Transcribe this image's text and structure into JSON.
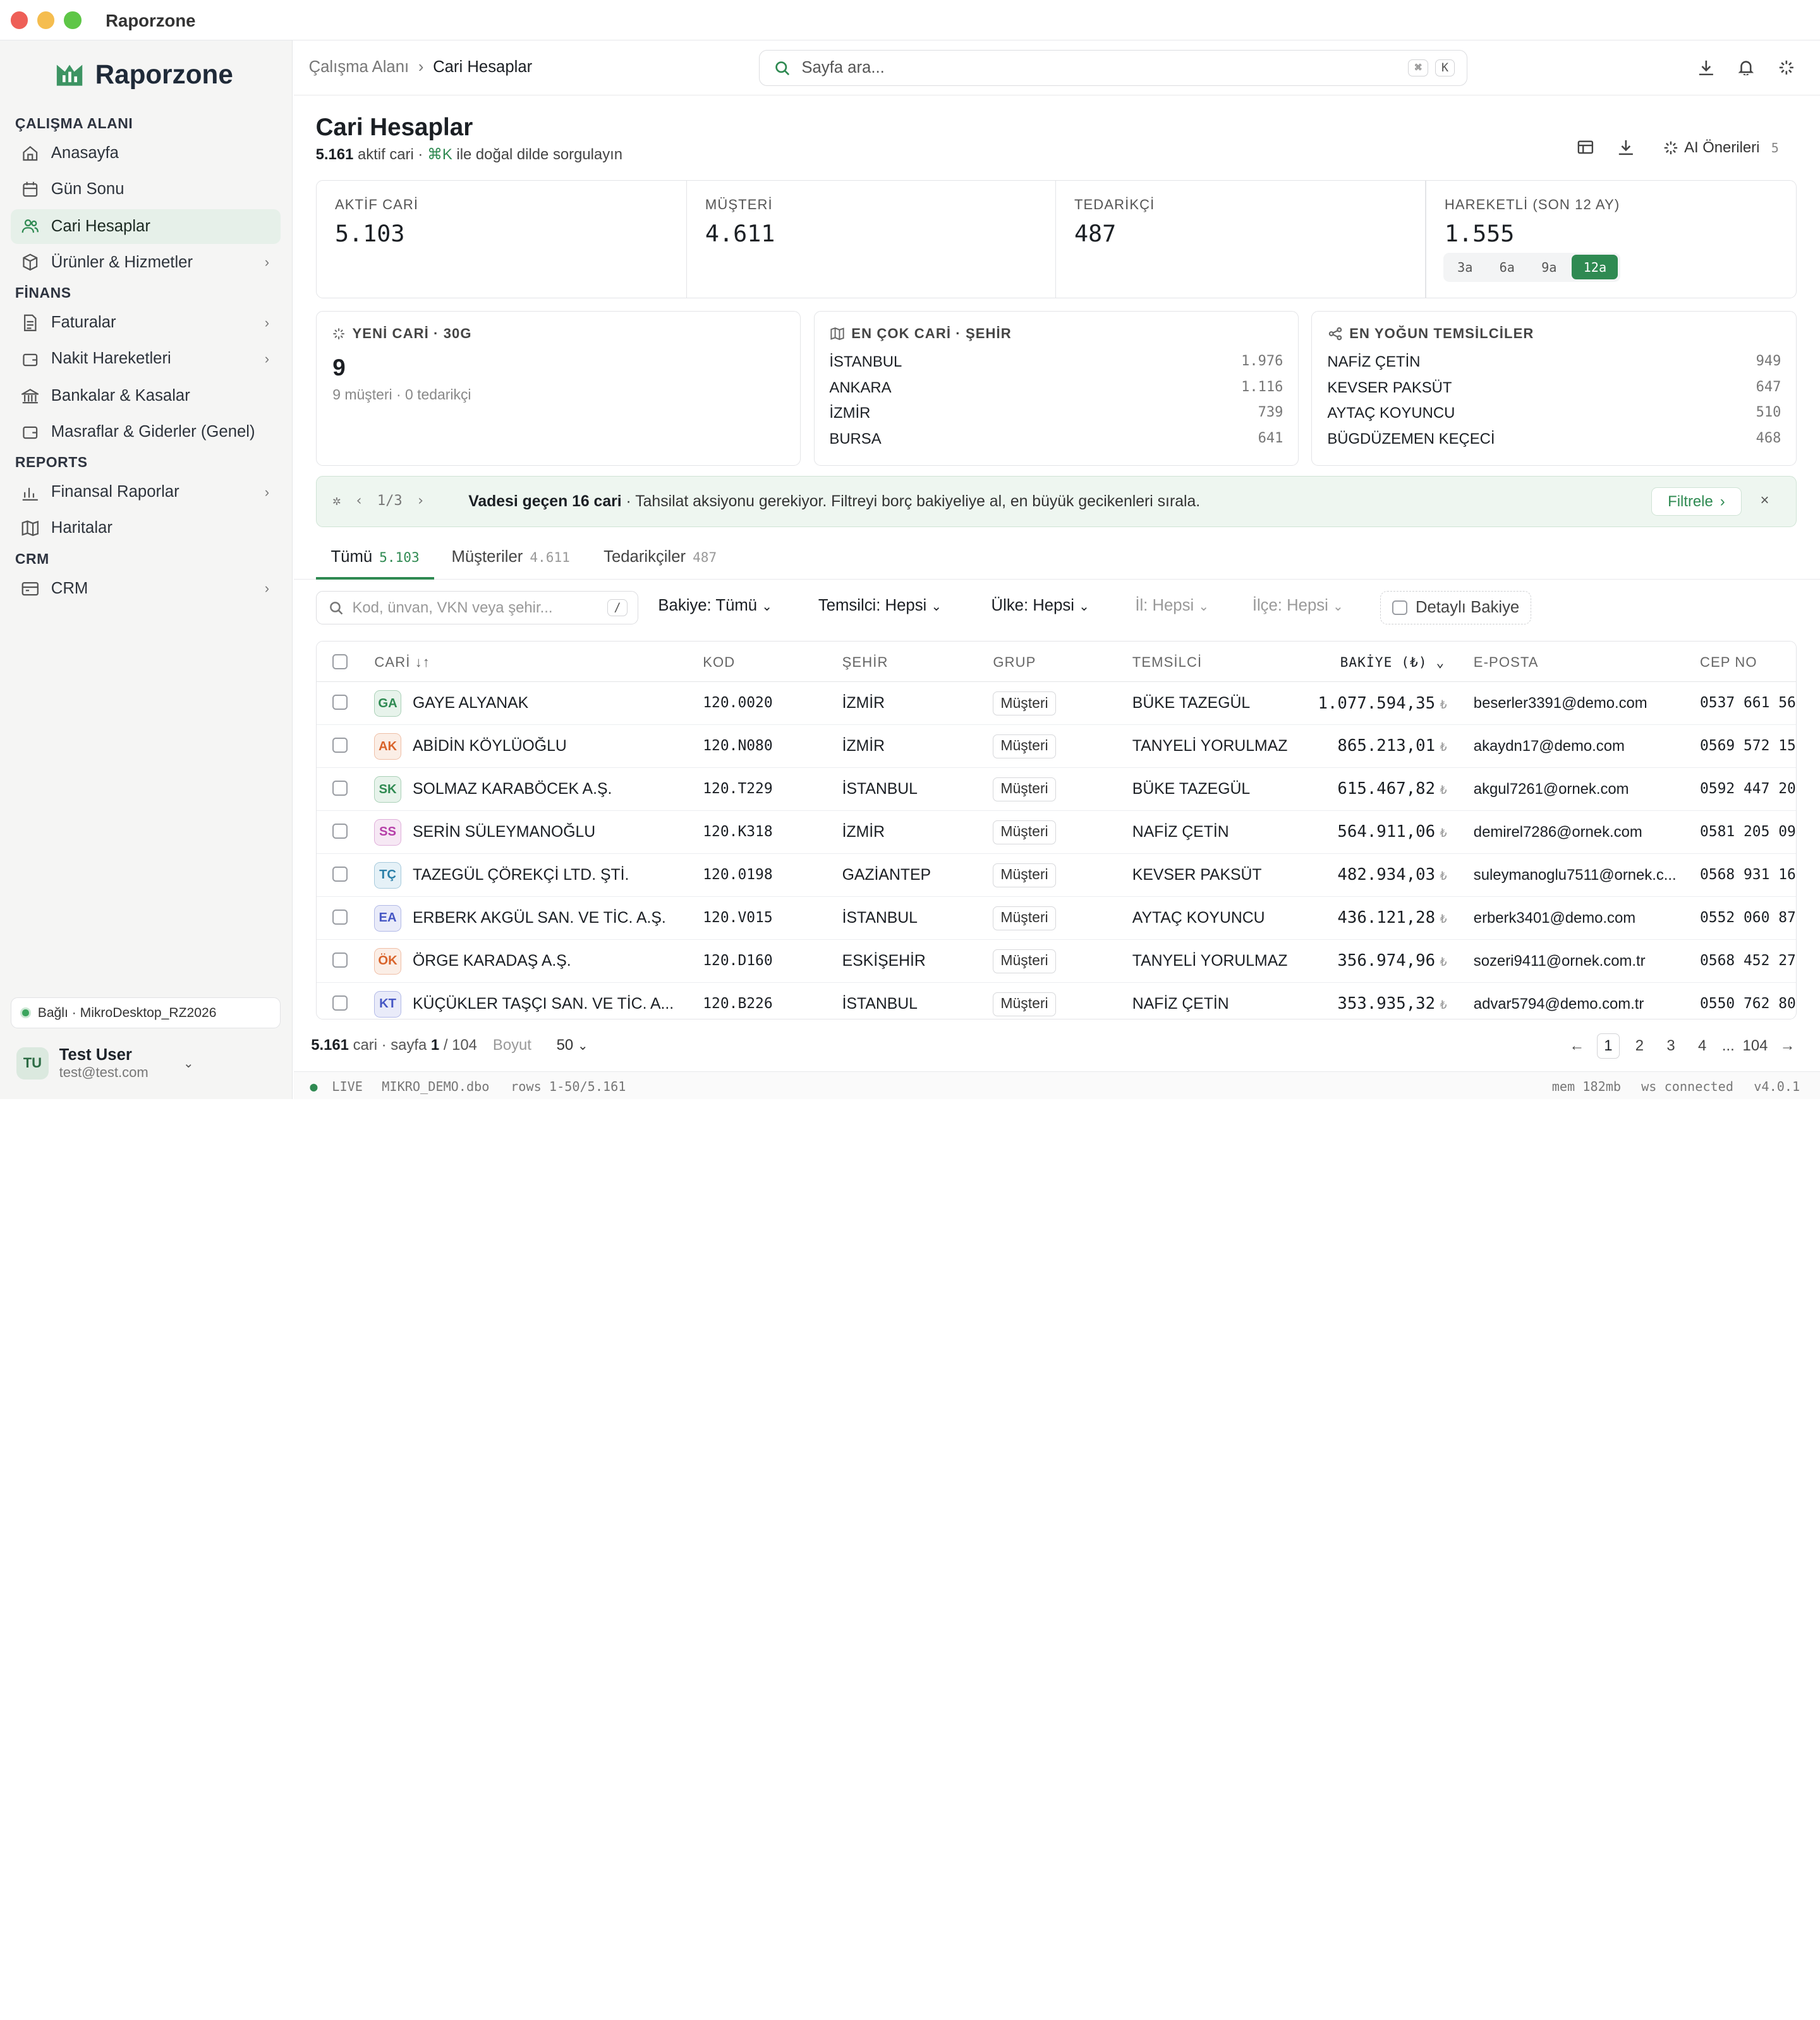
{
  "window": {
    "title": "Raporzone",
    "controls": {
      "close": "#ee5f57",
      "minimize": "#f5bd4f",
      "maximize": "#5ec647"
    }
  },
  "sidebar": {
    "brand": "Raporzone",
    "sections": [
      {
        "title": "ÇALIŞMA ALANI",
        "items": [
          {
            "label": "Anasayfa",
            "icon": "home-icon"
          },
          {
            "label": "Gün Sonu",
            "icon": "calendar-icon"
          },
          {
            "label": "Cari Hesaplar",
            "icon": "users-icon",
            "active": true
          },
          {
            "label": "Ürünler & Hizmetler",
            "icon": "box-icon",
            "chevron": true
          }
        ]
      },
      {
        "title": "FİNANS",
        "items": [
          {
            "label": "Faturalar",
            "icon": "file-icon",
            "chevron": true
          },
          {
            "label": "Nakit Hareketleri",
            "icon": "wallet-icon",
            "chevron": true
          },
          {
            "label": "Bankalar & Kasalar",
            "icon": "bank-icon"
          },
          {
            "label": "Masraflar & Giderler (Genel)",
            "icon": "receipt-icon"
          }
        ]
      },
      {
        "title": "REPORTS",
        "items": [
          {
            "label": "Finansal Raporlar",
            "icon": "bar-chart-icon",
            "chevron": true
          },
          {
            "label": "Haritalar",
            "icon": "map-icon"
          }
        ]
      },
      {
        "title": "CRM",
        "items": [
          {
            "label": "CRM",
            "icon": "crm-icon",
            "chevron": true
          }
        ]
      }
    ],
    "connection": "Bağlı · MikroDesktop_RZ2026",
    "user": {
      "initials": "TU",
      "name": "Test User",
      "email": "test@test.com"
    }
  },
  "topbar": {
    "breadcrumb": [
      "Çalışma Alanı",
      "Cari Hesaplar"
    ],
    "search_placeholder": "Sayfa ara...",
    "kbd": [
      "⌘",
      "K"
    ]
  },
  "page": {
    "title": "Cari Hesaplar",
    "subtitle_count": "5.161",
    "subtitle_a": "aktif cari ·",
    "subtitle_kbd": "⌘K",
    "subtitle_b": "ile doğal dilde sorgulayın",
    "ai_label": "AI Önerileri",
    "ai_count": "5"
  },
  "kpis": [
    {
      "label": "AKTİF CARİ",
      "value": "5.103"
    },
    {
      "label": "MÜŞTERİ",
      "value": "4.611"
    },
    {
      "label": "TEDARİKÇİ",
      "value": "487"
    },
    {
      "label": "HAREKETLİ (SON 12 AY)",
      "value": "1.555",
      "periods": [
        "3a",
        "6a",
        "9a",
        "12a"
      ],
      "selected": "12a"
    }
  ],
  "cards": {
    "new": {
      "title": "YENİ CARİ · 30G",
      "value": "9",
      "sub": "9 müşteri · 0 tedarikçi"
    },
    "cities": {
      "title": "EN ÇOK CARİ · ŞEHİR",
      "rows": [
        {
          "name": "İSTANBUL",
          "n": "1.976"
        },
        {
          "name": "ANKARA",
          "n": "1.116"
        },
        {
          "name": "İZMİR",
          "n": "739"
        },
        {
          "name": "BURSA",
          "n": "641"
        }
      ]
    },
    "reps": {
      "title": "EN YOĞUN TEMSİLCİLER",
      "rows": [
        {
          "name": "NAFİZ ÇETİN",
          "n": "949"
        },
        {
          "name": "KEVSER PAKSÜT",
          "n": "647"
        },
        {
          "name": "AYTAÇ KOYUNCU",
          "n": "510"
        },
        {
          "name": "BÜGDÜZEMEN KEÇECİ",
          "n": "468"
        }
      ]
    }
  },
  "banner": {
    "pager": "1/3",
    "bold": "Vadesi geçen 16 cari",
    "text": "· Tahsilat aksiyonu gerekiyor. Filtreyi borç bakiyeliye al, en büyük gecikenleri sırala.",
    "button": "Filtrele"
  },
  "tabs": [
    {
      "label": "Tümü",
      "count": "5.103"
    },
    {
      "label": "Müşteriler",
      "count": "4.611"
    },
    {
      "label": "Tedarikçiler",
      "count": "487"
    }
  ],
  "filters": {
    "search_placeholder": "Kod, ünvan, VKN veya şehir...",
    "search_kbd": "/",
    "bakiye": "Bakiye: Tümü",
    "temsilci": "Temsilci: Hepsi",
    "ulke": "Ülke: Hepsi",
    "il": "İl: Hepsi",
    "ilce": "İlçe: Hepsi",
    "detayli": "Detaylı Bakiye"
  },
  "table": {
    "headers": {
      "cari": "CARİ",
      "kod": "KOD",
      "sehir": "ŞEHİR",
      "grup": "GRUP",
      "temsilci": "TEMSİLCİ",
      "bakiye": "BAKİYE (₺)",
      "eposta": "E-POSTA",
      "cep": "CEP NO"
    },
    "rows": [
      {
        "ini": "GA",
        "color": "#2f8a52",
        "name": "GAYE ALYANAK",
        "kod": "120.0020",
        "sehir": "İZMİR",
        "grup": "Müşteri",
        "temsilci": "BÜKE TAZEGÜL",
        "bakiye": "1.077.594,35",
        "eposta": "beserler3391@demo.com",
        "cep": "0537 661 56"
      },
      {
        "ini": "AK",
        "color": "#d9642b",
        "name": "ABİDİN KÖYLÜOĞLU",
        "kod": "120.N080",
        "sehir": "İZMİR",
        "grup": "Müşteri",
        "temsilci": "TANYELİ YORULMAZ",
        "bakiye": "865.213,01",
        "eposta": "akaydn17@demo.com",
        "cep": "0569 572 15"
      },
      {
        "ini": "SK",
        "color": "#2f8a52",
        "name": "SOLMAZ KARABÖCEK A.Ş.",
        "kod": "120.T229",
        "sehir": "İSTANBUL",
        "grup": "Müşteri",
        "temsilci": "BÜKE TAZEGÜL",
        "bakiye": "615.467,82",
        "eposta": "akgul7261@ornek.com",
        "cep": "0592 447 20"
      },
      {
        "ini": "SS",
        "color": "#b53fa8",
        "name": "SERİN SÜLEYMANOĞLU",
        "kod": "120.K318",
        "sehir": "İZMİR",
        "grup": "Müşteri",
        "temsilci": "NAFİZ ÇETİN",
        "bakiye": "564.911,06",
        "eposta": "demirel7286@ornek.com",
        "cep": "0581 205 09"
      },
      {
        "ini": "TÇ",
        "color": "#2a7fa8",
        "name": "TAZEGÜL ÇÖREKÇİ LTD. ŞTİ.",
        "kod": "120.0198",
        "sehir": "GAZİANTEP",
        "grup": "Müşteri",
        "temsilci": "KEVSER PAKSÜT",
        "bakiye": "482.934,03",
        "eposta": "suleymanoglu7511@ornek.c...",
        "cep": "0568 931 16"
      },
      {
        "ini": "EA",
        "color": "#4657c4",
        "name": "ERBERK AKGÜL SAN. VE TİC. A.Ş.",
        "kod": "120.V015",
        "sehir": "İSTANBUL",
        "grup": "Müşteri",
        "temsilci": "AYTAÇ KOYUNCU",
        "bakiye": "436.121,28",
        "eposta": "erberk3401@demo.com",
        "cep": "0552 060 87"
      },
      {
        "ini": "ÖK",
        "color": "#d9642b",
        "name": "ÖRGE KARADAŞ A.Ş.",
        "kod": "120.D160",
        "sehir": "ESKİŞEHİR",
        "grup": "Müşteri",
        "temsilci": "TANYELİ YORULMAZ",
        "bakiye": "356.974,96",
        "eposta": "sozeri9411@ornek.com.tr",
        "cep": "0568 452 27"
      },
      {
        "ini": "KT",
        "color": "#4657c4",
        "name": "KÜÇÜKLER TAŞÇI SAN. VE TİC. A...",
        "kod": "120.B226",
        "sehir": "İSTANBUL",
        "grup": "Müşteri",
        "temsilci": "NAFİZ ÇETİN",
        "bakiye": "353.935,32",
        "eposta": "advar5794@demo.com.tr",
        "cep": "0550 762 80"
      }
    ]
  },
  "footer": {
    "count": "5.161",
    "a": "cari · sayfa",
    "page": "1",
    "total": "/ 104",
    "size_label": "Boyut",
    "size": "50",
    "pages": [
      "1",
      "2",
      "3",
      "4",
      "...",
      "104"
    ]
  },
  "status": {
    "live": "LIVE",
    "db": "MIKRO_DEMO.dbo",
    "rows": "rows 1-50/5.161",
    "mem": "mem 182mb",
    "ws": "ws connected",
    "ver": "v4.0.1"
  },
  "currency_symbol": "₺",
  "colors": {
    "accent": "#2f8a52"
  }
}
